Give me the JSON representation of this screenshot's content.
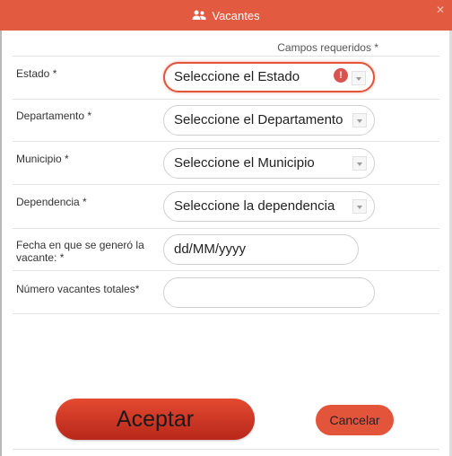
{
  "dialog": {
    "title": "Vacantes",
    "title_icon": "users-icon",
    "close_icon": "close-icon"
  },
  "form": {
    "required_note": "Campos requeridos *",
    "estado": {
      "label": "Estado *",
      "value": "Seleccione el Estado",
      "error_icon": "exclamation-icon",
      "error_mark": "!"
    },
    "departamento": {
      "label": "Departamento *",
      "value": "Seleccione el Departamento"
    },
    "municipio": {
      "label": "Municipio *",
      "value": "Seleccione el Municipio"
    },
    "dependencia": {
      "label": "Dependencia *",
      "value": "Seleccione la dependencia"
    },
    "fecha": {
      "label": "Fecha en que se generó la vacante: *",
      "placeholder": "dd/MM/yyyy",
      "value": ""
    },
    "numero": {
      "label": "Número vacantes totales*",
      "value": ""
    }
  },
  "actions": {
    "accept_label": "Aceptar",
    "cancel_label": "Cancelar"
  },
  "colors": {
    "accent": "#e25a3f",
    "accept_button": "#c8321e",
    "error": "#d9534f"
  }
}
